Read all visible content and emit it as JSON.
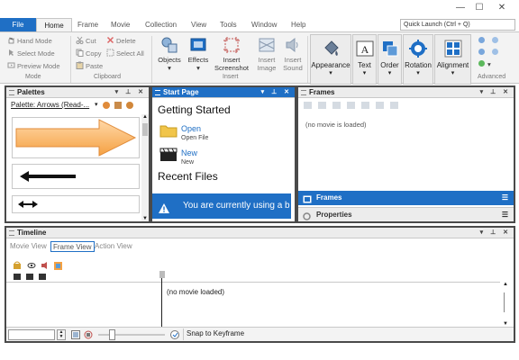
{
  "window": {
    "menu_tabs": [
      "File",
      "Home",
      "Frame",
      "Movie",
      "Collection",
      "View",
      "Tools",
      "Window",
      "Help"
    ],
    "quick_launch_placeholder": "Quick Launch (Ctrl + Q)",
    "controls": [
      "—",
      "☐",
      "✕"
    ]
  },
  "ribbon": {
    "mode": {
      "label": "Mode",
      "items": [
        "Hand Mode",
        "Select Mode",
        "Preview Mode"
      ]
    },
    "clipboard": {
      "label": "Clipboard",
      "items": [
        "Cut",
        "Delete",
        "Copy",
        "Select All",
        "Paste"
      ]
    },
    "insert": {
      "label": "Insert",
      "objects": "Objects",
      "effects": "Effects",
      "screenshot": "Insert Screenshot",
      "image": "Insert Image",
      "sound": "Insert Sound"
    },
    "format": {
      "appearance": "Appearance",
      "text": "Text",
      "order": "Order",
      "rotation": "Rotation",
      "alignment": "Alignment"
    },
    "advanced": {
      "label": "Advanced"
    }
  },
  "palettes": {
    "title": "Palettes",
    "selector": "Palette: Arrows (Read-..."
  },
  "start_page": {
    "title": "Start Page",
    "getting_started": "Getting Started",
    "open_label": "Open",
    "open_sub": "Open File",
    "new_label": "New",
    "new_sub": "New",
    "recent_files": "Recent Files",
    "banner": "You are currently using a b"
  },
  "frames": {
    "title": "Frames",
    "empty": "(no movie is loaded)",
    "tab_frames": "Frames",
    "tab_properties": "Properties"
  },
  "timeline": {
    "title": "Timeline",
    "tabs": [
      "Movie View",
      "Frame View",
      "Action View"
    ],
    "empty": "(no movie loaded)",
    "snap_label": "Snap to Keyframe"
  },
  "colors": {
    "accent": "#1f6fc5",
    "arrow_orange": "#f5a142",
    "panel_border": "#4a4a4a"
  }
}
